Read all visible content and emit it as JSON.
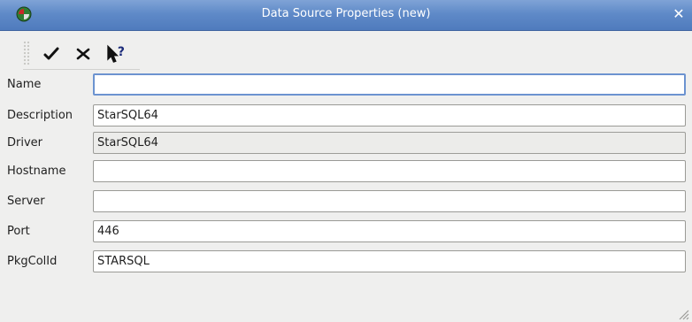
{
  "window": {
    "title": "Data Source Properties (new)",
    "close_glyph": "✕",
    "app_icon": "pipeline-app-icon"
  },
  "toolbar": {
    "ok_icon": "check-icon",
    "cancel_icon": "x-icon",
    "help_icon": "whats-this-help-icon"
  },
  "form": {
    "name": {
      "label": "Name",
      "value": ""
    },
    "description": {
      "label": "Description",
      "value": "StarSQL64"
    },
    "driver": {
      "label": "Driver",
      "value": "StarSQL64"
    },
    "hostname": {
      "label": "Hostname",
      "value": ""
    },
    "server": {
      "label": "Server",
      "value": ""
    },
    "port": {
      "label": "Port",
      "value": "446"
    },
    "pkgcollid": {
      "label": "PkgColId",
      "value": "STARSQL"
    }
  },
  "colors": {
    "titlebar": "#5f8ac8",
    "focus_border": "#6c93d0",
    "background": "#efefee"
  }
}
